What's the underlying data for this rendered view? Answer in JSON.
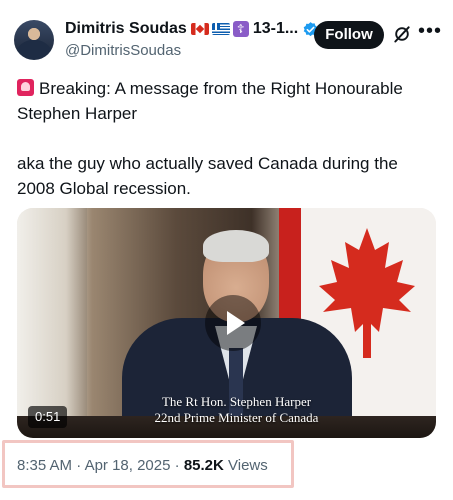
{
  "author": {
    "display_name": "Dimitris Soudas",
    "name_suffix": "13-1...",
    "handle": "@DimitrisSoudas",
    "follow_label": "Follow",
    "more_label": "•••"
  },
  "tweet": {
    "line1": "Breaking: A message from the Right Honourable Stephen Harper",
    "line2": "aka the guy who actually saved Canada during the 2008 Global recession."
  },
  "video": {
    "caption_line1": "The Rt Hon. Stephen Harper",
    "caption_line2": "22nd Prime Minister of Canada",
    "duration": "0:51"
  },
  "meta": {
    "time": "8:35 AM",
    "separator1": " · ",
    "date": "Apr 18, 2025",
    "separator2": " · ",
    "views_count": "85.2K",
    "views_label": " Views"
  },
  "colors": {
    "follow_bg": "#0f1419",
    "verified": "#1d9bf0",
    "muted_text": "#536471",
    "highlight_box": "#f2c6c2"
  }
}
